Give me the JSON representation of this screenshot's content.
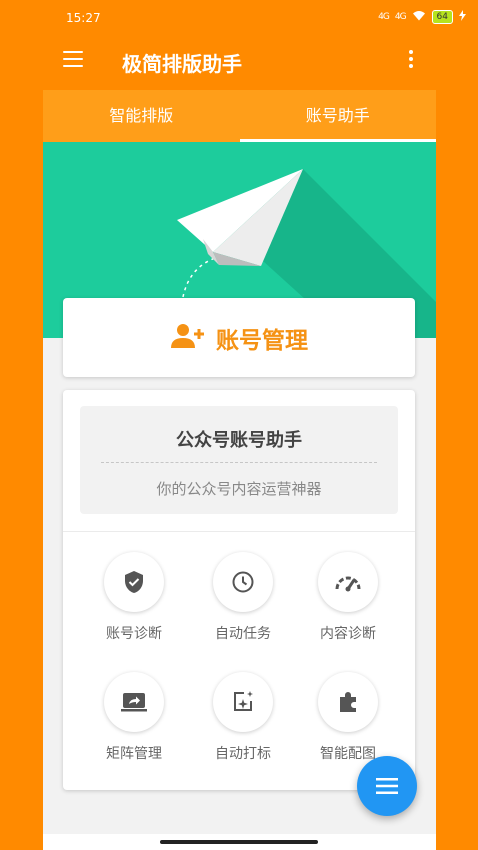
{
  "status_bar": {
    "time": "15:27",
    "signal_1": "4G",
    "signal_2": "4G",
    "battery": "64"
  },
  "app_bar": {
    "title": "极简排版助手"
  },
  "tabs": [
    {
      "label": "智能排版",
      "active": false
    },
    {
      "label": "账号助手",
      "active": true
    }
  ],
  "account_card": {
    "title": "账号管理"
  },
  "info_box": {
    "title": "公众号账号助手",
    "subtitle": "你的公众号内容运营神器"
  },
  "grid": [
    {
      "label": "账号诊断",
      "icon": "shield-check-icon"
    },
    {
      "label": "自动任务",
      "icon": "clock-icon"
    },
    {
      "label": "内容诊断",
      "icon": "gauge-icon"
    },
    {
      "label": "矩阵管理",
      "icon": "share-screen-icon"
    },
    {
      "label": "自动打标",
      "icon": "auto-tag-icon"
    },
    {
      "label": "智能配图",
      "icon": "puzzle-icon"
    }
  ],
  "colors": {
    "primary": "#FF8A00",
    "tab_bar": "#FF9E19",
    "banner": "#1DCC9C",
    "accent_text": "#F59214",
    "fab": "#2196F3"
  }
}
